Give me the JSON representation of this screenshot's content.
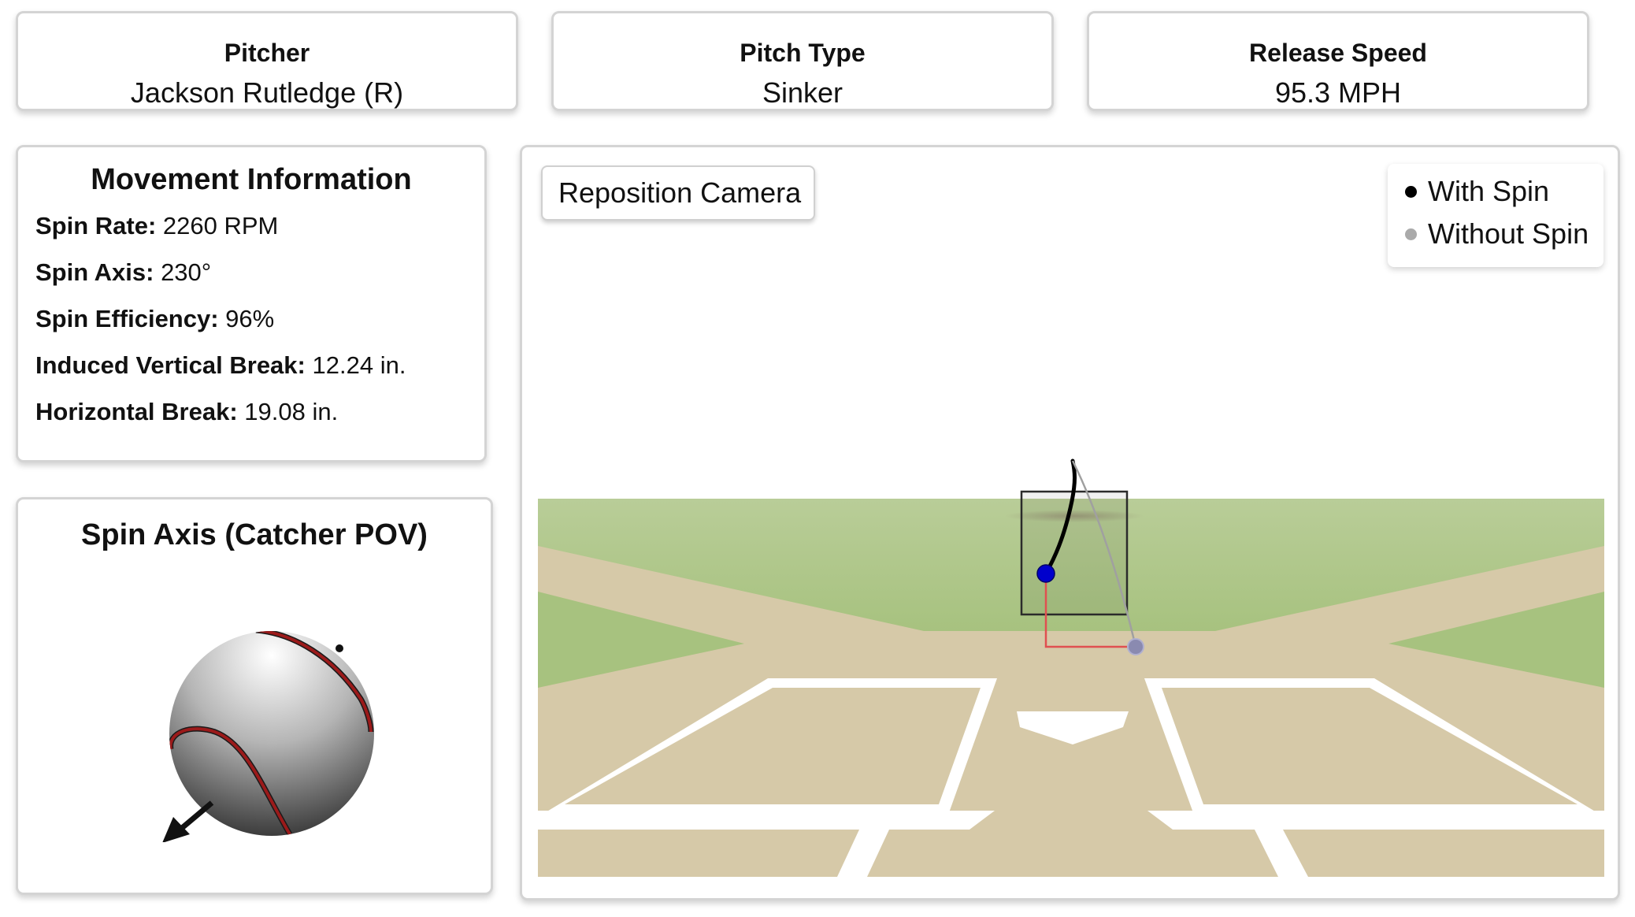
{
  "pitcher": {
    "label": "Pitcher",
    "value": "Jackson Rutledge (R)"
  },
  "pitch_type": {
    "label": "Pitch Type",
    "value": "Sinker"
  },
  "release_speed": {
    "label": "Release Speed",
    "value": "95.3 MPH"
  },
  "movement": {
    "title": "Movement Information",
    "stats": [
      {
        "label": "Spin Rate:",
        "value": "2260 RPM"
      },
      {
        "label": "Spin Axis:",
        "value": "230°"
      },
      {
        "label": "Spin Efficiency:",
        "value": "96%"
      },
      {
        "label": "Induced Vertical Break:",
        "value": "12.24 in."
      },
      {
        "label": "Horizontal Break:",
        "value": "19.08 in."
      }
    ]
  },
  "spin_axis": {
    "title": "Spin Axis (Catcher POV)",
    "axis_degrees": 230
  },
  "visualizer": {
    "reposition_label": "Reposition Camera",
    "legend": [
      {
        "label": "With Spin",
        "color": "#000000"
      },
      {
        "label": "Without Spin",
        "color": "#aaaaaa"
      }
    ]
  },
  "colors": {
    "grass": "#b6cc93",
    "dirt": "#d6c9a8",
    "chalk": "#ffffff",
    "ball_with_spin": "#0000cc",
    "ball_without_spin": "#8a8ab0",
    "break_line": "#e05050",
    "seam": "#9b1a1a"
  }
}
